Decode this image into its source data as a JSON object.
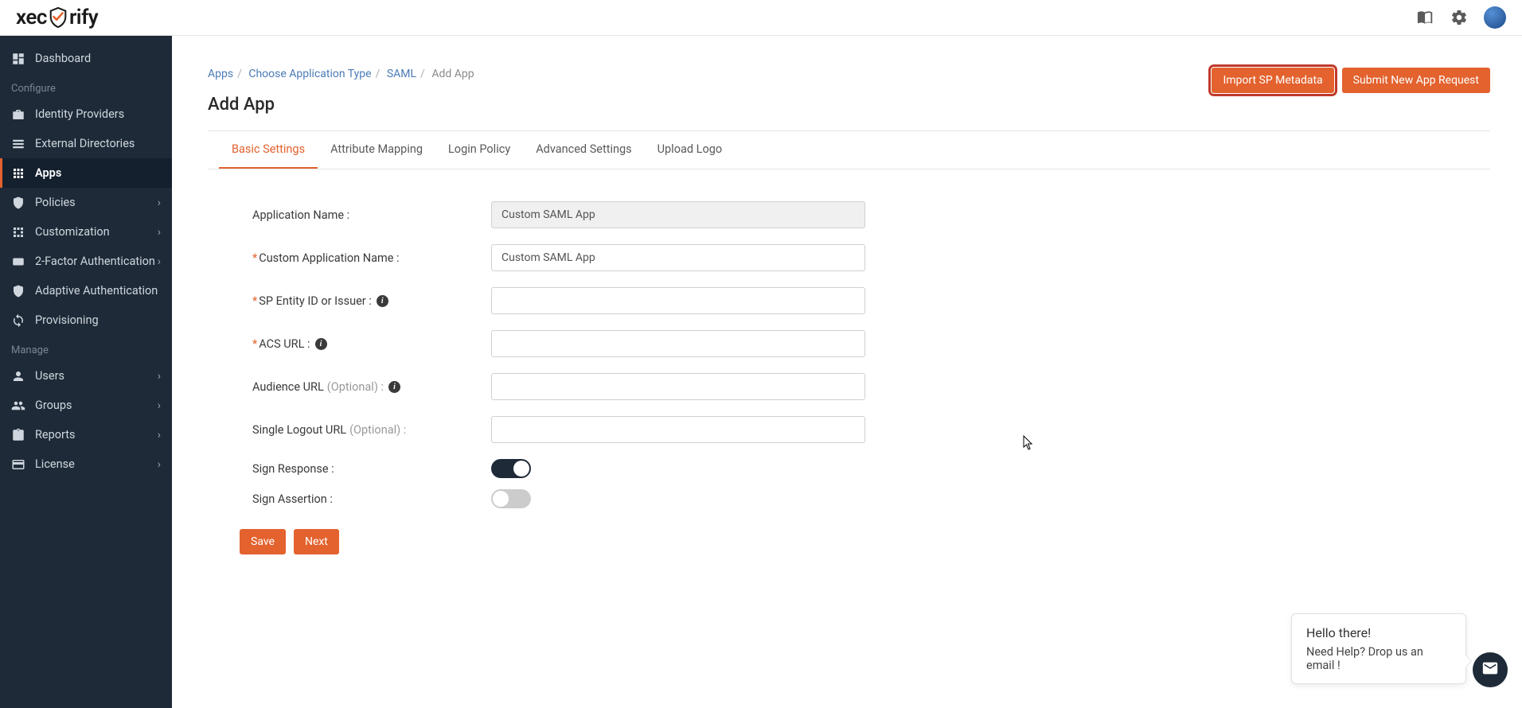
{
  "header": {
    "logo_left": "xec",
    "logo_right": "rify"
  },
  "sidebar": {
    "section_configure": "Configure",
    "section_manage": "Manage",
    "items": {
      "dashboard": "Dashboard",
      "identity": "Identity Providers",
      "external": "External Directories",
      "apps": "Apps",
      "policies": "Policies",
      "customization": "Customization",
      "twofa": "2-Factor Authentication",
      "adaptive": "Adaptive Authentication",
      "provisioning": "Provisioning",
      "users": "Users",
      "groups": "Groups",
      "reports": "Reports",
      "license": "License"
    }
  },
  "breadcrumb": {
    "apps": "Apps",
    "choose": "Choose Application Type",
    "saml": "SAML",
    "current": "Add App"
  },
  "page_title": "Add App",
  "actions": {
    "import": "Import SP Metadata",
    "submit": "Submit New App Request"
  },
  "tabs": {
    "basic": "Basic Settings",
    "attribute": "Attribute Mapping",
    "login": "Login Policy",
    "advanced": "Advanced Settings",
    "logo": "Upload Logo"
  },
  "form": {
    "app_name_label": "Application Name :",
    "app_name_value": "Custom SAML App",
    "custom_name_label": "Custom Application Name :",
    "custom_name_value": "Custom SAML App",
    "sp_entity_label": "SP Entity ID or Issuer :",
    "sp_entity_value": "",
    "acs_label": "ACS URL :",
    "acs_value": "",
    "audience_label": "Audience URL",
    "audience_optional": "(Optional) :",
    "audience_value": "",
    "slo_label": "Single Logout URL",
    "slo_optional": "(Optional) :",
    "slo_value": "",
    "sign_response_label": "Sign Response :",
    "sign_assertion_label": "Sign Assertion :"
  },
  "buttons": {
    "save": "Save",
    "next": "Next"
  },
  "chat": {
    "greeting": "Hello there!",
    "help": "Need Help? Drop us an email !"
  }
}
